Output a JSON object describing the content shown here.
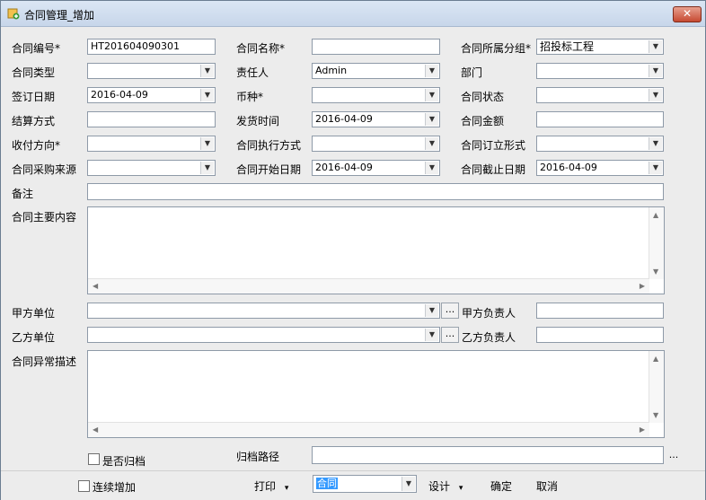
{
  "window": {
    "title": "合同管理_增加",
    "close_label": "✕"
  },
  "labels": {
    "contract_no": "合同编号*",
    "contract_name": "合同名称*",
    "contract_group": "合同所属分组*",
    "contract_type": "合同类型",
    "responsible": "责任人",
    "department": "部门",
    "sign_date": "签订日期",
    "currency": "币种*",
    "contract_status": "合同状态",
    "settlement": "结算方式",
    "ship_time": "发货时间",
    "amount": "合同金额",
    "pay_direction": "收付方向*",
    "exec_method": "合同执行方式",
    "order_form": "合同订立形式",
    "purchase_source": "合同采购来源",
    "start_date": "合同开始日期",
    "end_date": "合同截止日期",
    "remark": "备注",
    "main_content": "合同主要内容",
    "party_a": "甲方单位",
    "party_a_contact": "甲方负责人",
    "party_b": "乙方单位",
    "party_b_contact": "乙方负责人",
    "anomaly": "合同异常描述",
    "archived": "是否归档",
    "archive_path": "归档路径"
  },
  "values": {
    "contract_no": "HT201604090301",
    "contract_name": "",
    "contract_group": "招投标工程",
    "contract_type": "",
    "responsible": "Admin",
    "department": "",
    "sign_date": "2016-04-09",
    "currency": "",
    "contract_status": "",
    "settlement": "",
    "ship_time": "2016-04-09",
    "amount": "",
    "pay_direction": "",
    "exec_method": "",
    "order_form": "",
    "purchase_source": "",
    "start_date": "2016-04-09",
    "end_date": "2016-04-09",
    "remark": "",
    "party_a": "",
    "party_a_contact": "",
    "party_b": "",
    "party_b_contact": "",
    "archive_path": ""
  },
  "buttons": {
    "ellipsis": "...",
    "ellipsis_short": "..."
  },
  "bottom": {
    "continuous_add": "连续增加",
    "print": "打印",
    "template_value": "合同",
    "design": "设计",
    "ok": "确定",
    "cancel": "取消",
    "menu_arrow": "▾"
  }
}
